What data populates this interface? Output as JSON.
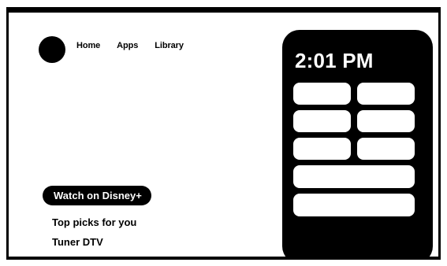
{
  "nav": {
    "items": [
      {
        "label": "Home"
      },
      {
        "label": "Apps"
      },
      {
        "label": "Library"
      }
    ]
  },
  "content": {
    "featured_label": "Watch on Disney+",
    "rows": [
      {
        "label": "Top picks for you"
      },
      {
        "label": "Tuner DTV"
      }
    ]
  },
  "clock_panel": {
    "time": "2:01 PM",
    "tile_count": 8
  },
  "colors": {
    "primary": "#000000",
    "background": "#ffffff"
  }
}
